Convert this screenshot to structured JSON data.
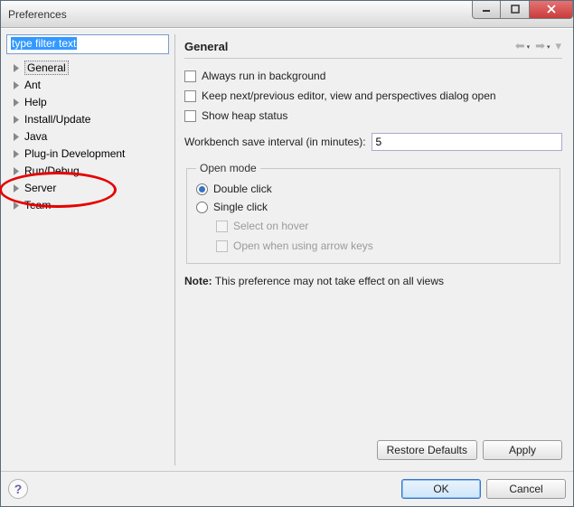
{
  "window": {
    "title": "Preferences"
  },
  "filter": {
    "text": "type filter text"
  },
  "tree": {
    "items": [
      {
        "label": "General"
      },
      {
        "label": "Ant"
      },
      {
        "label": "Help"
      },
      {
        "label": "Install/Update"
      },
      {
        "label": "Java"
      },
      {
        "label": "Plug-in Development"
      },
      {
        "label": "Run/Debug"
      },
      {
        "label": "Server"
      },
      {
        "label": "Team"
      }
    ]
  },
  "page": {
    "title": "General",
    "checks": {
      "always_run_bg": "Always run in background",
      "keep_next_prev": "Keep next/previous editor, view and perspectives dialog open",
      "show_heap": "Show heap status"
    },
    "save_interval_label": "Workbench save interval (in minutes):",
    "save_interval_value": "5",
    "open_mode": {
      "legend": "Open mode",
      "double_click": "Double click",
      "single_click": "Single click",
      "select_on_hover": "Select on hover",
      "open_arrow_keys": "Open when using arrow keys"
    },
    "note_label": "Note:",
    "note_text": " This preference may not take effect on all views"
  },
  "buttons": {
    "restore_defaults": "Restore Defaults",
    "apply": "Apply",
    "ok": "OK",
    "cancel": "Cancel"
  }
}
